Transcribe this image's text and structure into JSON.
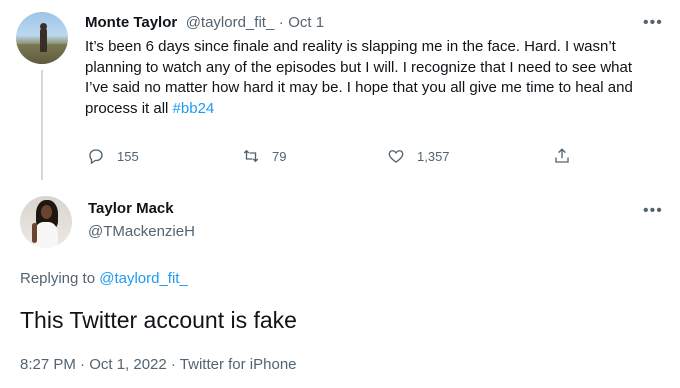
{
  "parent_tweet": {
    "author_name": "Monte Taylor",
    "handle": "@taylord_fit_",
    "separator": "·",
    "date": "Oct 1",
    "more_label": "•••",
    "text": "It’s been 6 days since finale and reality is slapping me in the face. Hard. I wasn’t planning to watch any of the episodes but I will. I recognize that I need to see what I’ve said no matter how hard it may be. I hope that you all give me time to heal and process it all ",
    "hashtag": "#bb24",
    "actions": {
      "reply_count": "155",
      "retweet_count": "79",
      "like_count": "1,357",
      "reply_icon": "reply-icon",
      "retweet_icon": "retweet-icon",
      "like_icon": "heart-icon",
      "share_icon": "share-icon"
    }
  },
  "reply_tweet": {
    "author_name": "Taylor Mack",
    "handle": "@TMackenzieH",
    "more_label": "•••",
    "replying_prefix": "Replying to ",
    "replying_to": "@taylord_fit_",
    "text": "This Twitter account is fake",
    "timestamp_line": "8:27 PM · Oct 1, 2022 · Twitter for iPhone"
  },
  "colors": {
    "text": "#0f1419",
    "secondary": "#536471",
    "link": "#1d9bf0",
    "thread_line": "#cfd9de"
  }
}
